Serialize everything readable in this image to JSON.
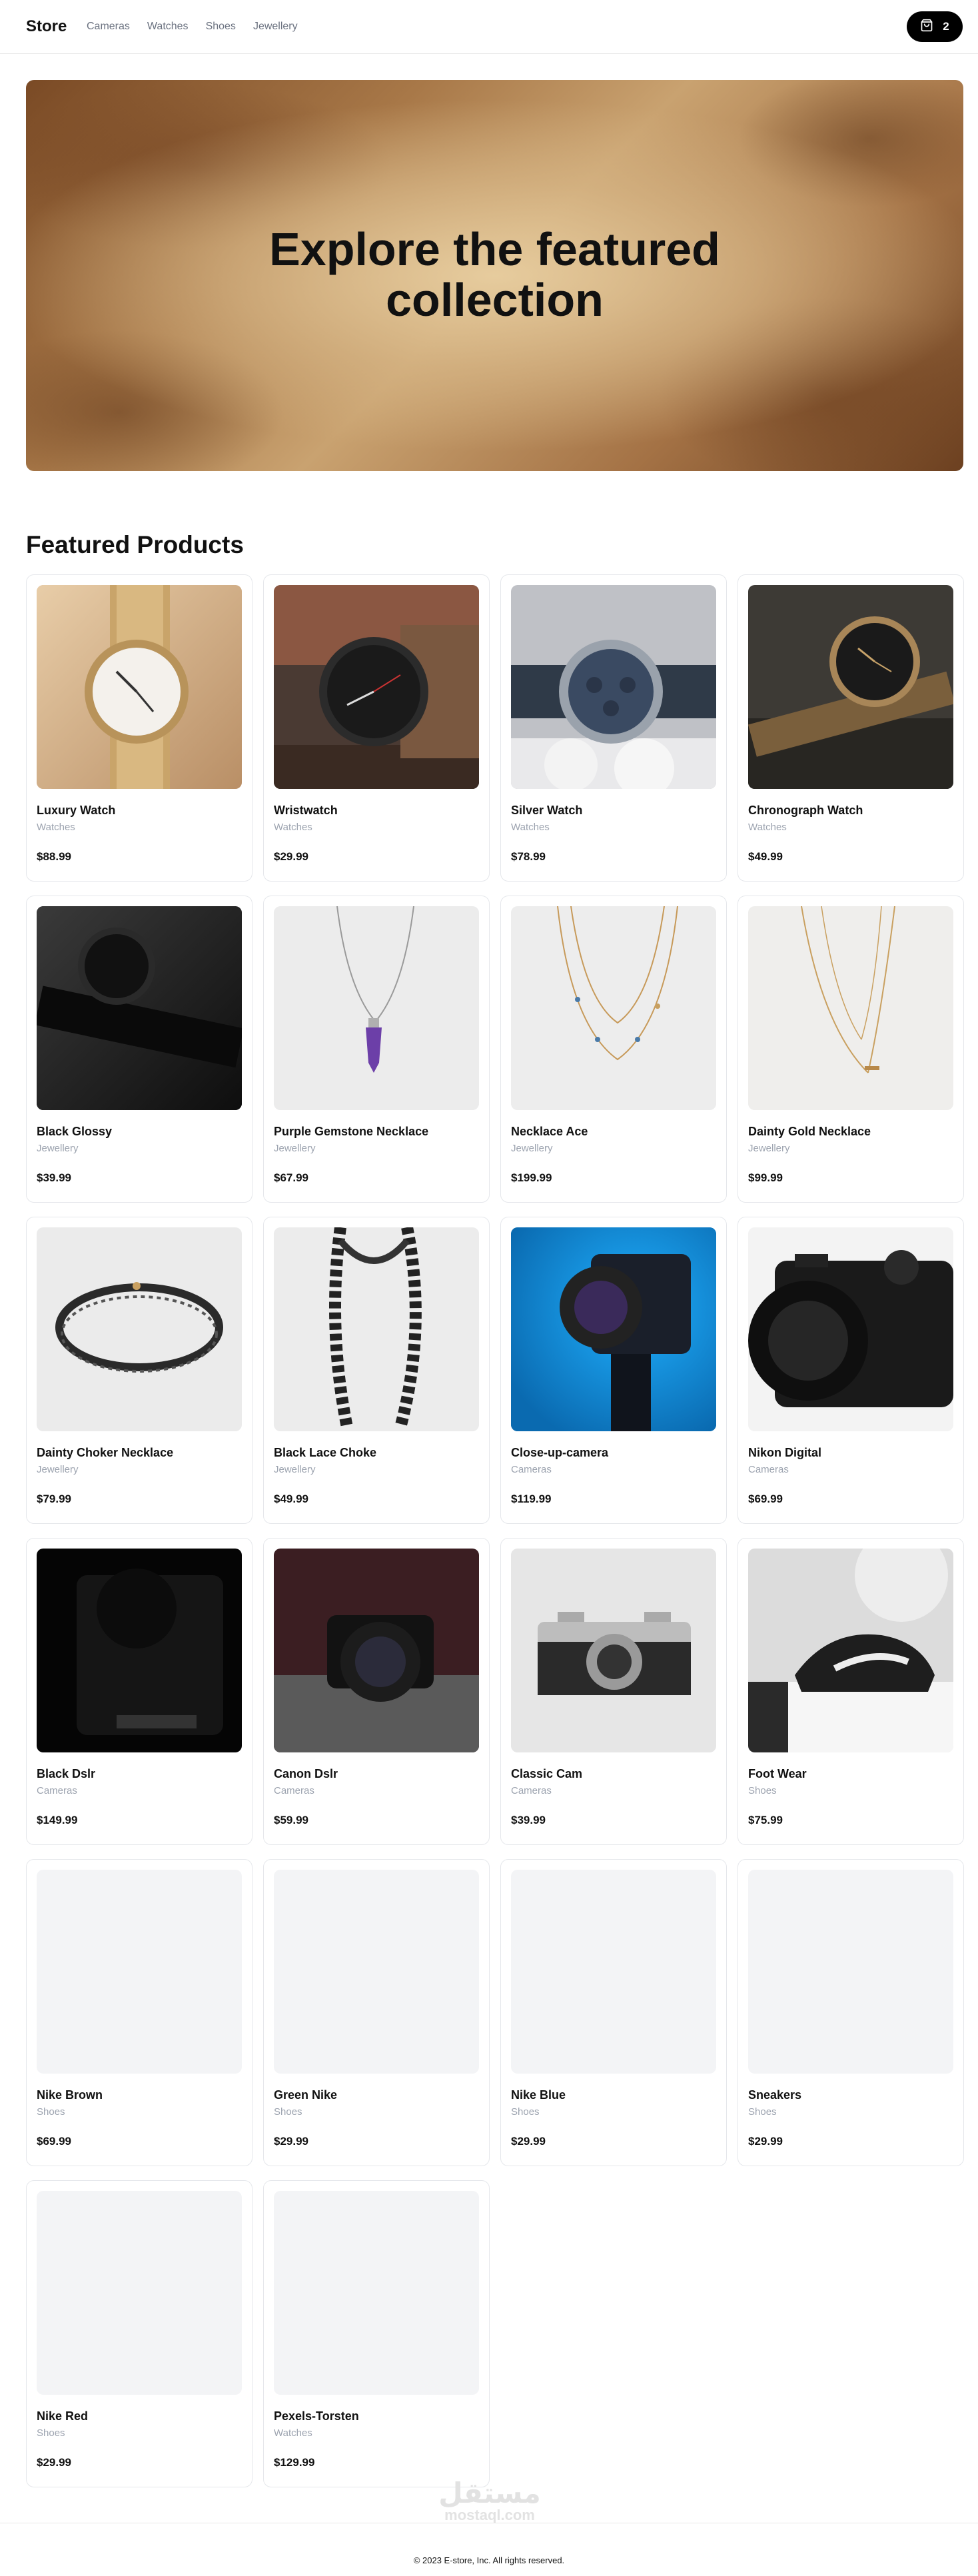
{
  "header": {
    "brand": "Store",
    "nav": [
      "Cameras",
      "Watches",
      "Shoes",
      "Jewellery"
    ],
    "cart_count": "2"
  },
  "billboard": {
    "title_line1": "Explore the featured",
    "title_line2": "collection"
  },
  "section_title": "Featured Products",
  "products": [
    {
      "name": "Luxury Watch",
      "category": "Watches",
      "price": "$88.99",
      "image": "gold-watch"
    },
    {
      "name": "Wristwatch",
      "category": "Watches",
      "price": "$29.99",
      "image": "black-leather-watch"
    },
    {
      "name": "Silver Watch",
      "category": "Watches",
      "price": "$78.99",
      "image": "silver-watch"
    },
    {
      "name": "Chronograph Watch",
      "category": "Watches",
      "price": "$49.99",
      "image": "chronograph-watch"
    },
    {
      "name": "Black Glossy",
      "category": "Jewellery",
      "price": "$39.99",
      "image": "black-watch"
    },
    {
      "name": "Purple Gemstone Necklace",
      "category": "Jewellery",
      "price": "$67.99",
      "image": "gemstone-necklace"
    },
    {
      "name": "Necklace Ace",
      "category": "Jewellery",
      "price": "$199.99",
      "image": "beaded-necklace"
    },
    {
      "name": "Dainty Gold Necklace",
      "category": "Jewellery",
      "price": "$99.99",
      "image": "gold-necklace"
    },
    {
      "name": "Dainty Choker Necklace",
      "category": "Jewellery",
      "price": "$79.99",
      "image": "choker"
    },
    {
      "name": "Black Lace Choke",
      "category": "Jewellery",
      "price": "$49.99",
      "image": "lace-choker"
    },
    {
      "name": "Close-up-camera",
      "category": "Cameras",
      "price": "$119.99",
      "image": "blue-camera"
    },
    {
      "name": "Nikon Digital",
      "category": "Cameras",
      "price": "$69.99",
      "image": "nikon-camera"
    },
    {
      "name": "Black Dslr",
      "category": "Cameras",
      "price": "$149.99",
      "image": "dark-dslr"
    },
    {
      "name": "Canon Dslr",
      "category": "Cameras",
      "price": "$59.99",
      "image": "canon-dslr"
    },
    {
      "name": "Classic Cam",
      "category": "Cameras",
      "price": "$39.99",
      "image": "classic-camera"
    },
    {
      "name": "Foot Wear",
      "category": "Shoes",
      "price": "$75.99",
      "image": "sneaker"
    },
    {
      "name": "Nike Brown",
      "category": "Shoes",
      "price": "$69.99",
      "image": "placeholder"
    },
    {
      "name": "Green Nike",
      "category": "Shoes",
      "price": "$29.99",
      "image": "placeholder"
    },
    {
      "name": "Nike Blue",
      "category": "Shoes",
      "price": "$29.99",
      "image": "placeholder"
    },
    {
      "name": "Sneakers",
      "category": "Shoes",
      "price": "$29.99",
      "image": "placeholder"
    },
    {
      "name": "Nike Red",
      "category": "Shoes",
      "price": "$29.99",
      "image": "placeholder"
    },
    {
      "name": "Pexels-Torsten",
      "category": "Watches",
      "price": "$129.99",
      "image": "placeholder"
    }
  ],
  "watermark": {
    "arabic": "مستقل",
    "latin": "mostaql.com"
  },
  "footer": "© 2023 E-store, Inc. All rights reserved."
}
